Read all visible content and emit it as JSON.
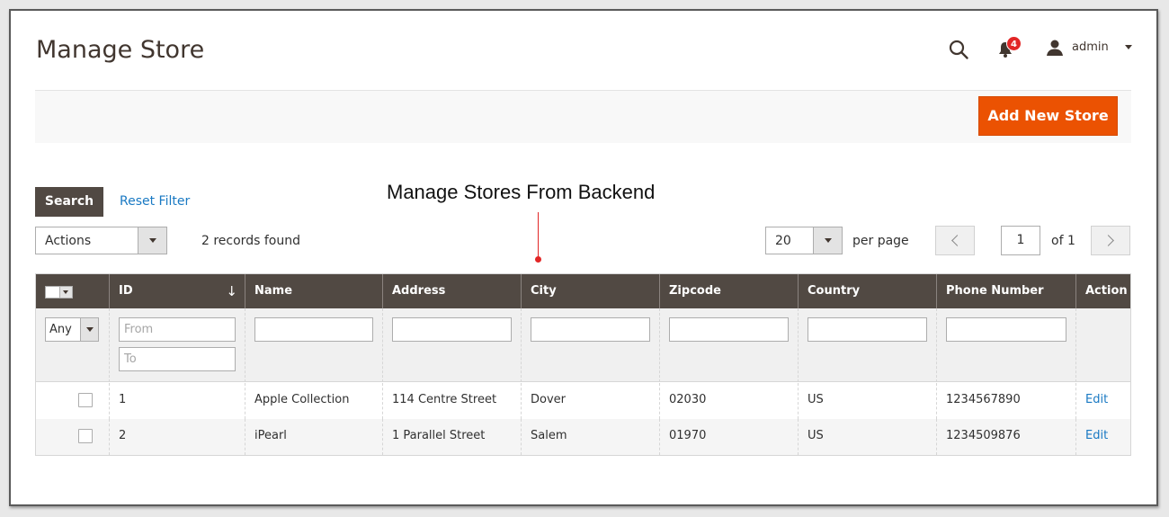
{
  "header": {
    "title": "Manage Store",
    "notification_count": "4",
    "user_name": "admin"
  },
  "toolbar": {
    "add_label": "Add New Store"
  },
  "filters": {
    "search_label": "Search",
    "reset_label": "Reset Filter",
    "actions_label": "Actions",
    "records_found": "2 records found",
    "per_page_value": "20",
    "per_page_label": "per page",
    "page_value": "1",
    "page_of": "of 1",
    "any_label": "Any",
    "id_from_placeholder": "From",
    "id_to_placeholder": "To"
  },
  "annotation": {
    "text": "Manage Stores From Backend"
  },
  "grid": {
    "columns": [
      "ID",
      "Name",
      "Address",
      "City",
      "Zipcode",
      "Country",
      "Phone Number",
      "Action"
    ],
    "rows": [
      {
        "id": "1",
        "name": "Apple Collection",
        "address": "114 Centre Street",
        "city": "Dover",
        "zipcode": "02030",
        "country": "US",
        "phone": "1234567890",
        "action": "Edit"
      },
      {
        "id": "2",
        "name": "iPearl",
        "address": "1 Parallel Street",
        "city": "Salem",
        "zipcode": "01970",
        "country": "US",
        "phone": "1234509876",
        "action": "Edit"
      }
    ]
  },
  "colors": {
    "accent": "#eb5202",
    "header_bg": "#514943",
    "link": "#1979c3",
    "badge": "#e22626"
  }
}
